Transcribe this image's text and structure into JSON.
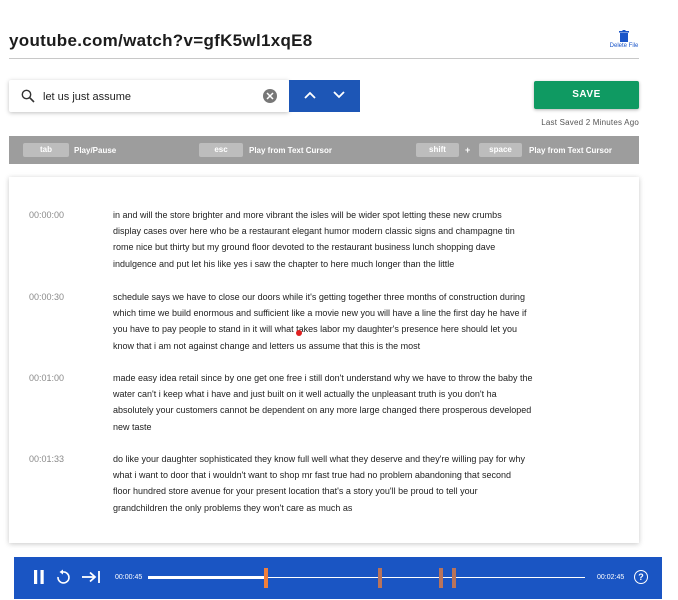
{
  "header": {
    "title": "youtube.com/watch?v=gfK5wl1xqE8",
    "delete_label": "Delete File",
    "delete_icon": "trash-icon"
  },
  "search": {
    "value": "let us just assume",
    "placeholder": "",
    "icon": "search-icon",
    "clear_icon": "clear-icon",
    "prev_icon": "chevron-up-icon",
    "next_icon": "chevron-down-icon"
  },
  "save": {
    "label": "SAVE",
    "status": "Last Saved 2 Minutes Ago"
  },
  "shortcuts": {
    "tab_key": "tab",
    "tab_action": "Play/Pause",
    "esc_key": "esc",
    "esc_action": "Play from Text Cursor",
    "shift_key": "shift",
    "plus": "+",
    "space_key": "space",
    "shift_space_action": "Play from Text Cursor"
  },
  "transcript": [
    {
      "timestamp": "00:00:00",
      "lines": [
        "in and will the store brighter and more vibrant the isles will be wider spot letting these new crumbs",
        "display cases over here who be a restaurant elegant humor modern classic signs and champagne tin",
        "rome nice but thirty but my ground floor devoted to the restaurant business lunch shopping dave",
        "indulgence and put let his like yes i saw the chapter to here much longer than the little"
      ]
    },
    {
      "timestamp": "00:00:30",
      "lines": [
        "schedule says we have to close our doors while it's getting together three months of construction during",
        "which time we build enormous and sufficient like a movie new you will have a line the first day he have if",
        "you have to pay people to stand in it will what takes labor my daughter's presence here should let you",
        "know that i am not against change and letters us assume that this is the most"
      ]
    },
    {
      "timestamp": "00:01:00",
      "lines": [
        "made easy idea retail since by one get one free i still don't understand why we have to throw the baby the",
        "water can't i keep what i have and just built on it well actually the unpleasant truth is you don't ha",
        "absolutely your customers cannot be dependent on any more large changed there prosperous developed",
        "new taste"
      ]
    },
    {
      "timestamp": "00:01:33",
      "lines": [
        "do like your daughter sophisticated they know full well what they deserve and they're willing pay for why",
        "what i want to door that i wouldn't want to shop mr fast true had no problem abandoning that second",
        "floor hundred store avenue for your present location that's a story you'll be proud to tell your",
        "grandchildren the only problems they won't care as much as"
      ]
    }
  ],
  "player": {
    "current_time": "00:00:45",
    "total_time": "00:02:45",
    "progress_fraction": 0.27,
    "pause_icon": "pause-icon",
    "replay_icon": "replay-icon",
    "skip_icon": "skip-to-end-icon",
    "help_icon": "help-icon",
    "help_glyph": "?",
    "markers": [
      {
        "position": 0.27,
        "color": "#f07f3c"
      },
      {
        "position": 0.53,
        "color": "#b9735a"
      },
      {
        "position": 0.67,
        "color": "#b9735a"
      },
      {
        "position": 0.7,
        "color": "#b9735a"
      }
    ]
  },
  "colors": {
    "accent_blue": "#1d56b6",
    "save_green": "#0f9a62",
    "shortcut_gray": "#9d9d9d",
    "cursor_red": "#e02020"
  }
}
